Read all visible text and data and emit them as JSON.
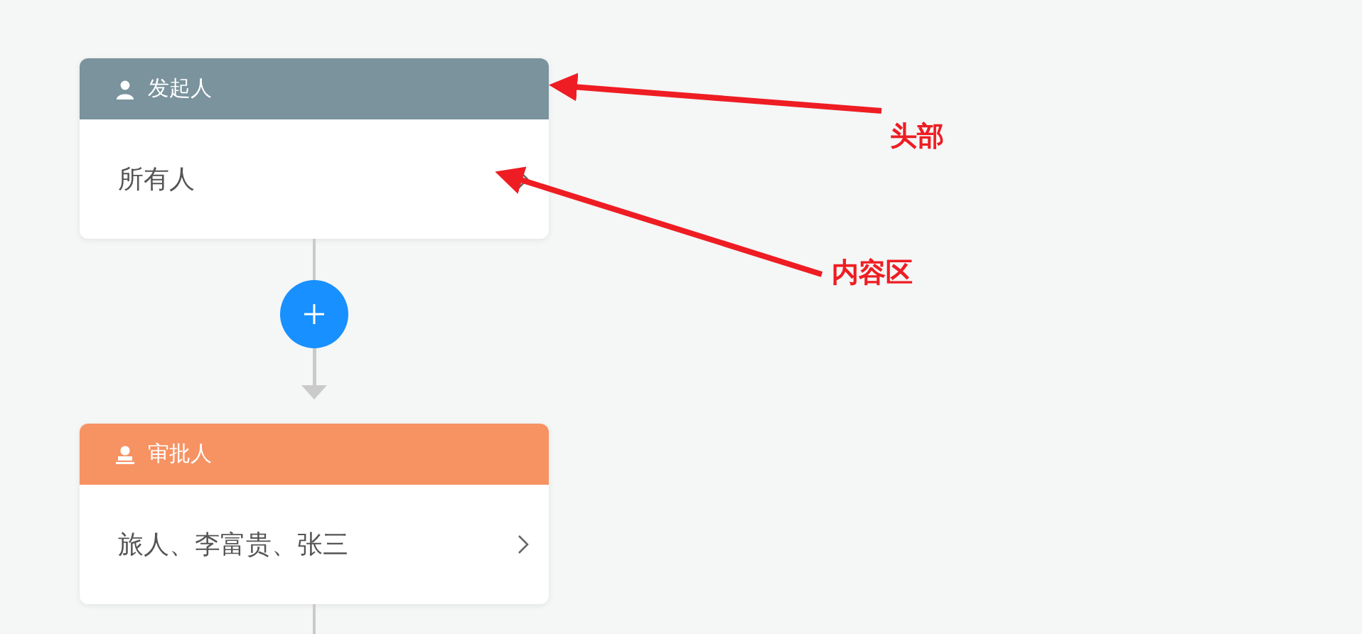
{
  "nodes": [
    {
      "kind": "initiator",
      "title": "发起人",
      "color": "#7a939d",
      "content": "所有人"
    },
    {
      "kind": "approver",
      "title": "审批人",
      "color": "#f79263",
      "content": "旅人、李富贵、张三"
    }
  ],
  "annotations": [
    {
      "label": "头部"
    },
    {
      "label": "内容区"
    }
  ]
}
